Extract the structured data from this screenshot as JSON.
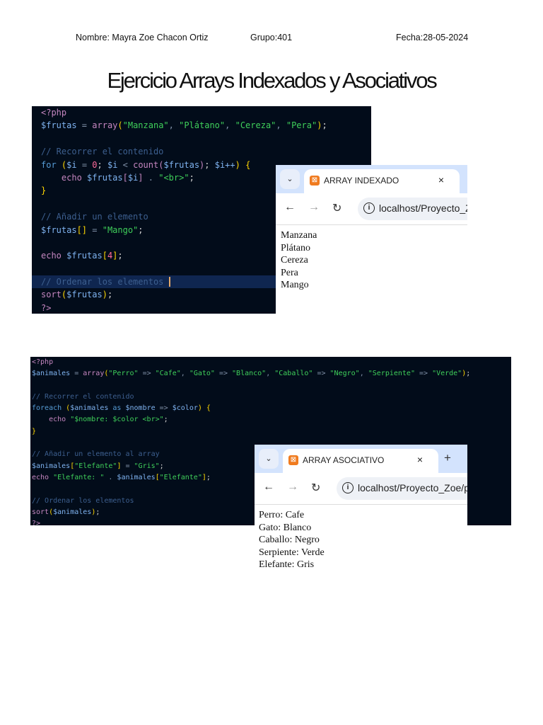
{
  "header": {
    "name": "Nombre: Mayra Zoe Chacon Ortiz",
    "group": "Grupo:401",
    "date": "Fecha:28-05-2024"
  },
  "title": "Ejercicio Arrays Indexados y Asociativos",
  "code1": [
    [
      [
        "<?php",
        "pk"
      ]
    ],
    [
      [
        "$frutas",
        "var"
      ],
      [
        " = ",
        "op"
      ],
      [
        "array",
        "fn"
      ],
      [
        "(",
        "br"
      ],
      [
        "\"Manzana\"",
        "str"
      ],
      [
        ", ",
        "op"
      ],
      [
        "\"Plátano\"",
        "str"
      ],
      [
        ", ",
        "op"
      ],
      [
        "\"Cereza\"",
        "str"
      ],
      [
        ", ",
        "op"
      ],
      [
        "\"Pera\"",
        "str"
      ],
      [
        ")",
        "br"
      ],
      [
        ";",
        "pl"
      ]
    ],
    [],
    [
      [
        "// Recorrer el contenido",
        "cm"
      ]
    ],
    [
      [
        "for ",
        "kw"
      ],
      [
        "(",
        "br"
      ],
      [
        "$i",
        "var"
      ],
      [
        " = ",
        "op"
      ],
      [
        "0",
        "num"
      ],
      [
        "; ",
        "pl"
      ],
      [
        "$i",
        "var"
      ],
      [
        " < ",
        "op"
      ],
      [
        "count",
        "fn"
      ],
      [
        "(",
        "pk"
      ],
      [
        "$frutas",
        "var"
      ],
      [
        ")",
        "pk"
      ],
      [
        "; ",
        "pl"
      ],
      [
        "$i++",
        "var"
      ],
      [
        ")",
        "br"
      ],
      [
        " {",
        "br"
      ]
    ],
    [
      [
        "    echo ",
        "fn"
      ],
      [
        "$frutas",
        "var"
      ],
      [
        "[",
        "pk"
      ],
      [
        "$i",
        "var"
      ],
      [
        "]",
        "pk"
      ],
      [
        " . ",
        "op"
      ],
      [
        "\"<br>\"",
        "str"
      ],
      [
        ";",
        "pl"
      ]
    ],
    [
      [
        "}",
        "br"
      ]
    ],
    [],
    [
      [
        "// Añadir un elemento",
        "cm"
      ]
    ],
    [
      [
        "$frutas",
        "var"
      ],
      [
        "[]",
        "br"
      ],
      [
        " = ",
        "op"
      ],
      [
        "\"Mango\"",
        "str"
      ],
      [
        ";",
        "pl"
      ]
    ],
    [],
    [
      [
        "echo ",
        "fn"
      ],
      [
        "$frutas",
        "var"
      ],
      [
        "[",
        "br"
      ],
      [
        "4",
        "num"
      ],
      [
        "]",
        "br"
      ],
      [
        ";",
        "pl"
      ]
    ],
    [],
    [
      [
        "// Ordenar los elementos ",
        "cm cur"
      ]
    ],
    [
      [
        "sort",
        "fn"
      ],
      [
        "(",
        "br"
      ],
      [
        "$frutas",
        "var"
      ],
      [
        ")",
        "br"
      ],
      [
        ";",
        "pl"
      ]
    ],
    [
      [
        "?>",
        "pk"
      ]
    ]
  ],
  "code2": [
    [
      [
        "<?php",
        "pk"
      ]
    ],
    [
      [
        "$animales",
        "var"
      ],
      [
        " = ",
        "op"
      ],
      [
        "array",
        "fn"
      ],
      [
        "(",
        "br"
      ],
      [
        "\"Perro\"",
        "str"
      ],
      [
        " => ",
        "op"
      ],
      [
        "\"Cafe\"",
        "str"
      ],
      [
        ", ",
        "op"
      ],
      [
        "\"Gato\"",
        "str"
      ],
      [
        " => ",
        "op"
      ],
      [
        "\"Blanco\"",
        "str"
      ],
      [
        ", ",
        "op"
      ],
      [
        "\"Caballo\"",
        "str"
      ],
      [
        " => ",
        "op"
      ],
      [
        "\"Negro\"",
        "str"
      ],
      [
        ", ",
        "op"
      ],
      [
        "\"Serpiente\"",
        "str"
      ],
      [
        " => ",
        "op"
      ],
      [
        "\"Verde\"",
        "str"
      ],
      [
        ")",
        "br"
      ],
      [
        ";",
        "pl"
      ]
    ],
    [],
    [
      [
        "// Recorrer el contenido",
        "cm"
      ]
    ],
    [
      [
        "foreach ",
        "kw"
      ],
      [
        "(",
        "br"
      ],
      [
        "$animales",
        "var"
      ],
      [
        " as ",
        "kw"
      ],
      [
        "$nombre",
        "var"
      ],
      [
        " => ",
        "op"
      ],
      [
        "$color",
        "var"
      ],
      [
        ")",
        "br"
      ],
      [
        " {",
        "br"
      ]
    ],
    [
      [
        "    echo ",
        "fn"
      ],
      [
        "\"$nombre: $color <br>\"",
        "str"
      ],
      [
        ";",
        "pl"
      ]
    ],
    [
      [
        "}",
        "br"
      ]
    ],
    [],
    [
      [
        "// Añadir un elemento al array",
        "cm"
      ]
    ],
    [
      [
        "$animales",
        "var"
      ],
      [
        "[",
        "br"
      ],
      [
        "\"Elefante\"",
        "str"
      ],
      [
        "]",
        "br"
      ],
      [
        " = ",
        "op"
      ],
      [
        "\"Gris\"",
        "str"
      ],
      [
        ";",
        "pl"
      ]
    ],
    [
      [
        "echo ",
        "fn"
      ],
      [
        "\"Elefante: \"",
        "str"
      ],
      [
        " . ",
        "op"
      ],
      [
        "$animales",
        "var"
      ],
      [
        "[",
        "br"
      ],
      [
        "\"Elefante\"",
        "str"
      ],
      [
        "]",
        "br"
      ],
      [
        ";",
        "pl"
      ]
    ],
    [],
    [
      [
        "// Ordenar los elementos",
        "cm"
      ]
    ],
    [
      [
        "sort",
        "fn"
      ],
      [
        "(",
        "br"
      ],
      [
        "$animales",
        "var"
      ],
      [
        ")",
        "br"
      ],
      [
        ";",
        "pl"
      ]
    ],
    [
      [
        "?>",
        "pk"
      ]
    ]
  ],
  "browser1": {
    "tab": "ARRAY INDEXADO",
    "close": "×",
    "url": "localhost/Proyecto_Z",
    "output": [
      "Manzana",
      "Plátano",
      "Cereza",
      "Pera",
      "Mango"
    ]
  },
  "browser2": {
    "tab": "ARRAY ASOCIATIVO",
    "close": "×",
    "new_tab": "+",
    "url": "localhost/Proyecto_Zoe/ph",
    "output": [
      "Perro: Cafe",
      "Gato: Blanco",
      "Caballo: Negro",
      "Serpiente: Verde",
      "Elefante: Gris"
    ]
  },
  "icons": {
    "dropdown": "⌄",
    "back": "←",
    "forward": "→",
    "reload": "↻",
    "info": "i",
    "favicon": "⊠"
  }
}
